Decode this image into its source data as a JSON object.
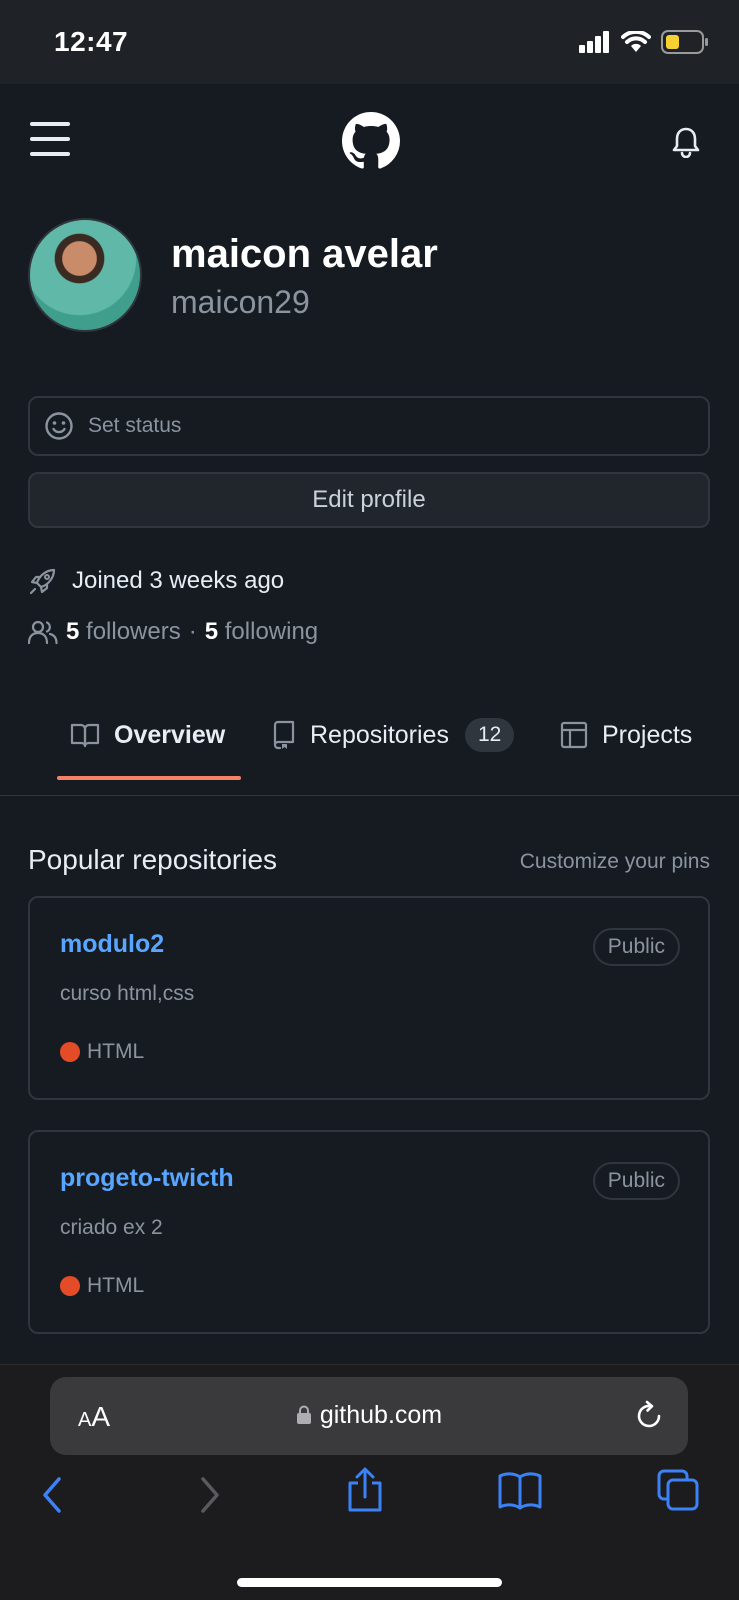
{
  "status_bar": {
    "time": "12:47"
  },
  "profile": {
    "name": "maicon avelar",
    "login": "maicon29",
    "set_status": "Set status",
    "edit_profile": "Edit profile",
    "joined": "Joined 3 weeks ago",
    "followers_count": "5",
    "followers_label": "followers",
    "separator": "·",
    "following_count": "5",
    "following_label": "following"
  },
  "tabs": [
    {
      "label": "Overview",
      "icon": "book-icon",
      "active": true
    },
    {
      "label": "Repositories",
      "icon": "repo-icon",
      "count": "12"
    },
    {
      "label": "Projects",
      "icon": "table-icon"
    }
  ],
  "popular": {
    "title": "Popular repositories",
    "customize": "Customize your pins",
    "repos": [
      {
        "name": "modulo2",
        "visibility": "Public",
        "description": "curso html,css",
        "language": "HTML",
        "language_color": "#e34c26"
      },
      {
        "name": "progeto-twicth",
        "visibility": "Public",
        "description": "criado ex 2",
        "language": "HTML",
        "language_color": "#e34c26"
      }
    ]
  },
  "browser": {
    "text_size_label_small": "A",
    "text_size_label_large": "A",
    "url": "github.com"
  },
  "colors": {
    "background": "#161b22",
    "link": "#58a6ff",
    "tab_underline": "#f78166",
    "browser_accent": "#3b82f6"
  }
}
